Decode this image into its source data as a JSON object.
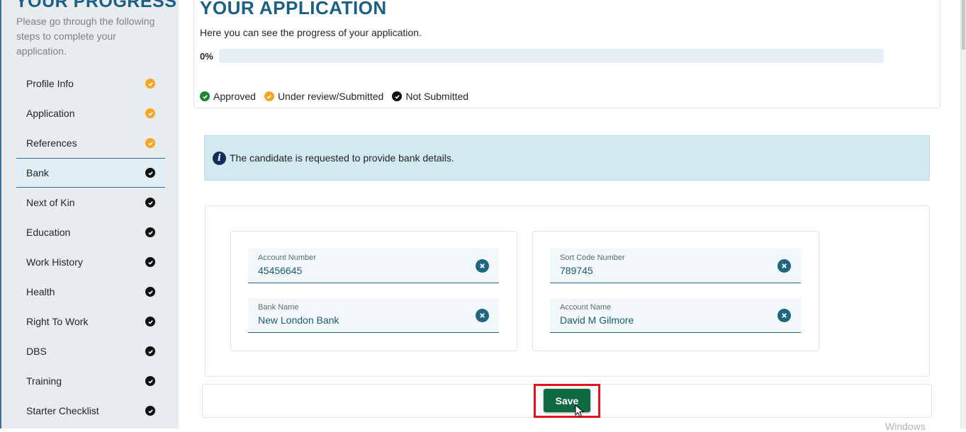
{
  "sidebar": {
    "title": "YOUR PROGRESS",
    "description": "Please go through the following steps to complete your application.",
    "items": [
      {
        "label": "Profile Info",
        "status": "orange"
      },
      {
        "label": "Application",
        "status": "orange"
      },
      {
        "label": "References",
        "status": "orange"
      },
      {
        "label": "Bank",
        "status": "black"
      },
      {
        "label": "Next of Kin",
        "status": "black"
      },
      {
        "label": "Education",
        "status": "black"
      },
      {
        "label": "Work History",
        "status": "black"
      },
      {
        "label": "Health",
        "status": "black"
      },
      {
        "label": "Right To Work",
        "status": "black"
      },
      {
        "label": "DBS",
        "status": "black"
      },
      {
        "label": "Training",
        "status": "black"
      },
      {
        "label": "Starter Checklist",
        "status": "black"
      }
    ],
    "active_item": "Bank"
  },
  "progress": {
    "title": "YOUR APPLICATION",
    "description": "Here you can see the progress of your application.",
    "percent_label": "0%",
    "percent_value": 0,
    "legend": {
      "approved": "Approved",
      "under_review": "Under review/Submitted",
      "not_submitted": "Not Submitted"
    }
  },
  "alert": {
    "icon": "info-icon",
    "text": "The candidate is requested to provide bank details."
  },
  "form": {
    "account_number": {
      "label": "Account Number",
      "value": "45456645"
    },
    "bank_name": {
      "label": "Bank Name",
      "value": "New London Bank"
    },
    "sort_code": {
      "label": "Sort Code Number",
      "value": "789745"
    },
    "account_name": {
      "label": "Account Name",
      "value": "David M Gilmore"
    }
  },
  "actions": {
    "save_label": "Save"
  },
  "watermark": "Windows",
  "colors": {
    "primary": "#1a5f86",
    "approved": "#198732",
    "under_review": "#f5a623",
    "not_submitted": "#111111",
    "save_button": "#106a41",
    "highlight": "#e3141c"
  }
}
